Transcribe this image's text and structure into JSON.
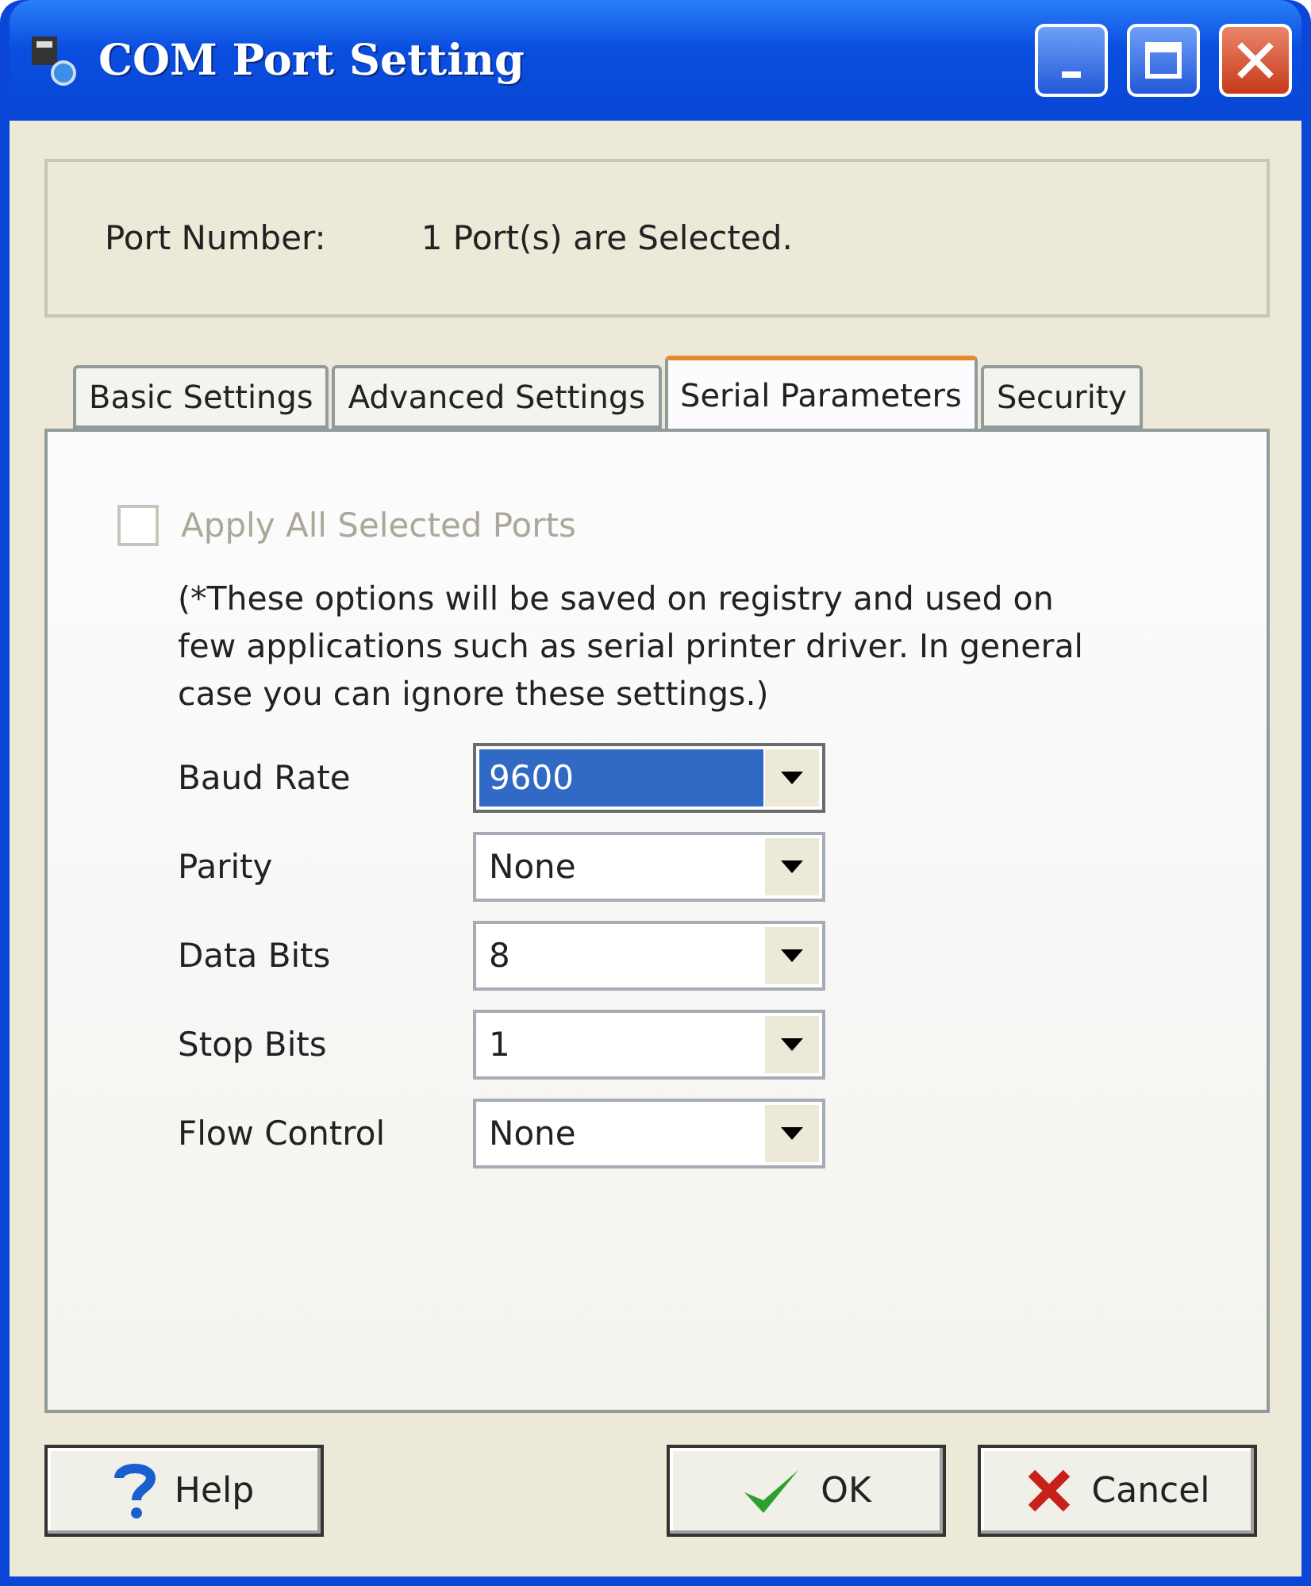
{
  "window": {
    "title": "COM Port Setting"
  },
  "port_number": {
    "label": "Port Number:",
    "value": "1 Port(s) are Selected."
  },
  "tabs": [
    {
      "label": "Basic Settings",
      "selected": false
    },
    {
      "label": "Advanced Settings",
      "selected": false
    },
    {
      "label": "Serial Parameters",
      "selected": true
    },
    {
      "label": "Security",
      "selected": false
    }
  ],
  "apply_all": {
    "label": "Apply All Selected Ports",
    "checked": false,
    "disabled": true
  },
  "note": "(*These options will be saved on registry and used on few applications such as serial printer driver. In general case you can ignore these settings.)",
  "fields": [
    {
      "label": "Baud Rate",
      "value": "9600",
      "focused": true
    },
    {
      "label": "Parity",
      "value": "None",
      "focused": false
    },
    {
      "label": "Data Bits",
      "value": "8",
      "focused": false
    },
    {
      "label": "Stop Bits",
      "value": "1",
      "focused": false
    },
    {
      "label": "Flow Control",
      "value": "None",
      "focused": false
    }
  ],
  "buttons": [
    {
      "kind": "help",
      "label": "Help"
    },
    {
      "kind": "ok",
      "label": "OK"
    },
    {
      "kind": "cancel",
      "label": "Cancel"
    }
  ]
}
